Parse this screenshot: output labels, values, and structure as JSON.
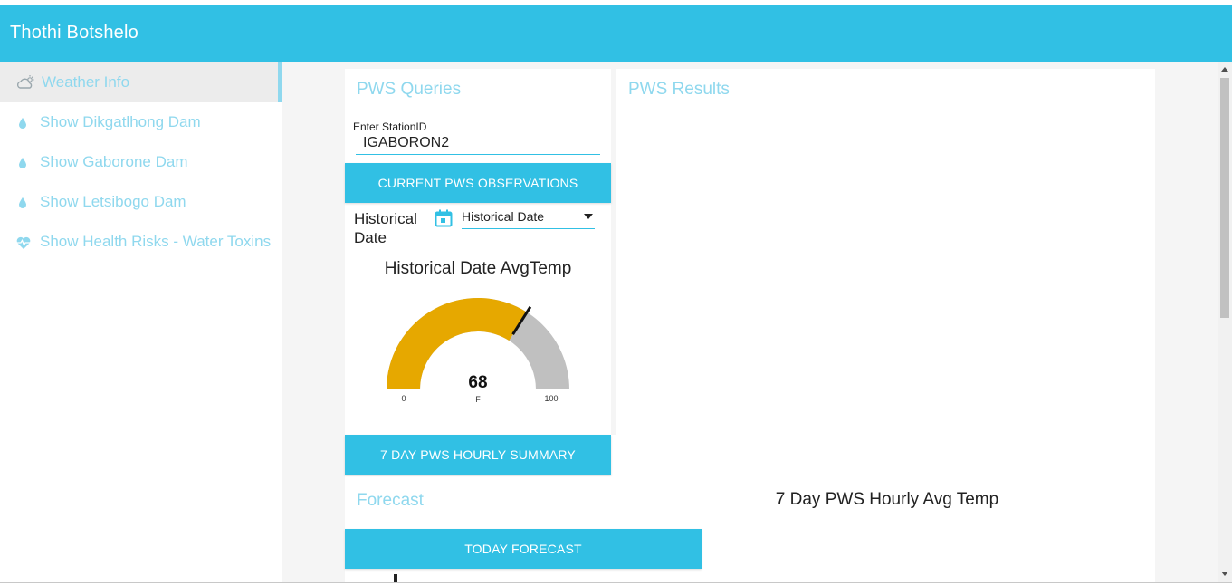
{
  "app": {
    "title": "Thothi Botshelo"
  },
  "sidebar": {
    "items": [
      {
        "label": "Weather Info",
        "icon": "cloud-sun-icon",
        "active": true
      },
      {
        "label": "Show Dikgatlhong Dam",
        "icon": "water-drop-icon"
      },
      {
        "label": "Show Gaborone Dam",
        "icon": "water-drop-icon"
      },
      {
        "label": "Show Letsibogo Dam",
        "icon": "water-drop-icon"
      },
      {
        "label": "Show Health Risks - Water Toxins",
        "icon": "heart-pulse-icon"
      }
    ]
  },
  "queries": {
    "title": "PWS Queries",
    "station_label": "Enter StationID",
    "station_value": "IGABORON2",
    "current_button": "CURRENT PWS OBSERVATIONS",
    "historical_label": "Historical Date",
    "historical_select": "Historical Date",
    "gauge": {
      "title": "Historical Date AvgTemp",
      "value": 68,
      "min": 0,
      "max": 100,
      "unit": "F",
      "fill_color": "#e6a800",
      "track_color": "#c0c0c0"
    },
    "summary_button": "7 DAY PWS HOURLY SUMMARY"
  },
  "results": {
    "title": "PWS Results"
  },
  "forecast": {
    "title": "Forecast",
    "button": "TODAY FORECAST"
  },
  "hourly": {
    "title": "7 Day PWS Hourly Avg Temp"
  },
  "colors": {
    "accent": "#31c0e4",
    "nav_text": "#8fd8ee"
  }
}
